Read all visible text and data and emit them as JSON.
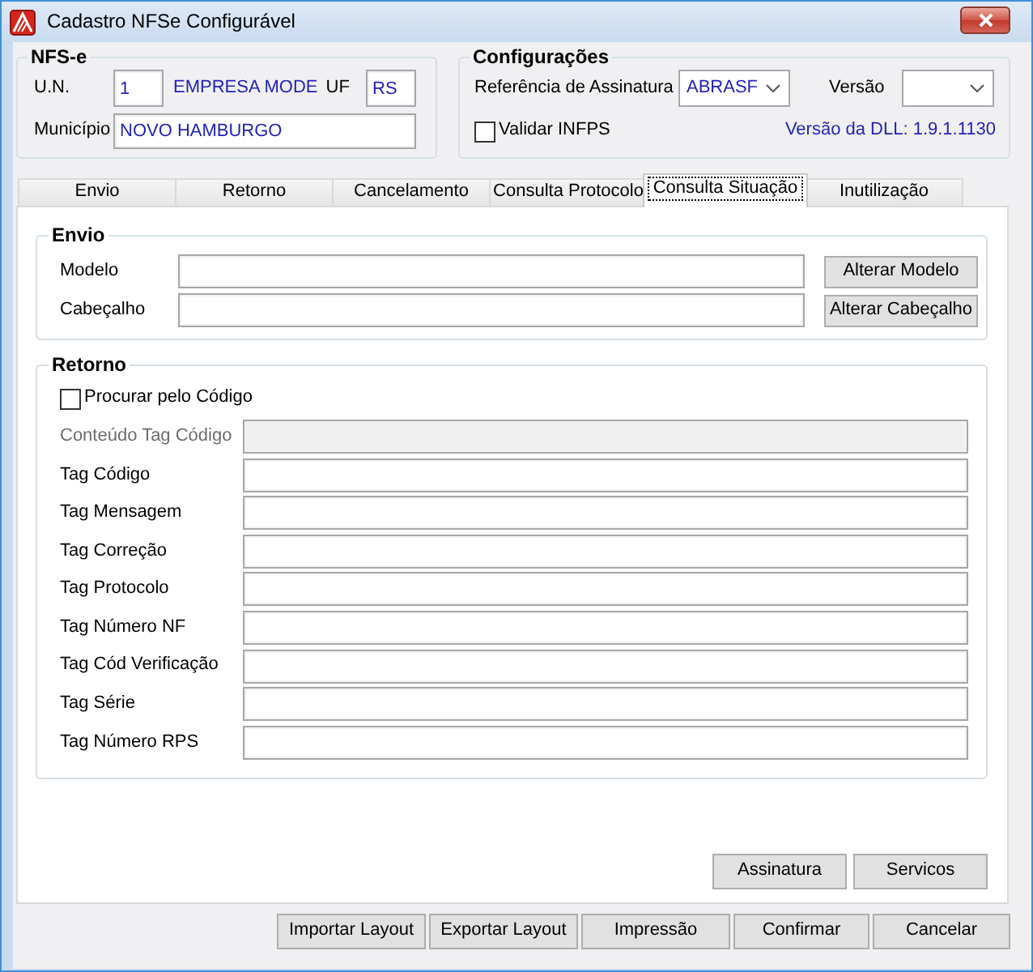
{
  "window": {
    "title": "Cadastro NFSe Configurável"
  },
  "nfse": {
    "title": "NFS-e",
    "un_label": "U.N.",
    "un_value": "1",
    "company": "EMPRESA MODE",
    "uf_label": "UF",
    "uf_value": "RS",
    "municipio_label": "Município",
    "municipio_value": "NOVO HAMBURGO"
  },
  "config": {
    "title": "Configurações",
    "signature_label": "Referência de Assinatura",
    "signature_value": "ABRASF",
    "version_label": "Versão",
    "validate": {
      "label": "Validar INFPS",
      "checked": false
    },
    "dll_version": "Versão da DLL: 1.9.1.1130"
  },
  "tabs": [
    {
      "label": "Envio",
      "selected": false
    },
    {
      "label": "Retorno",
      "selected": false
    },
    {
      "label": "Cancelamento",
      "selected": false
    },
    {
      "label": "Consulta Protocolo",
      "selected": false
    },
    {
      "label": "Consulta Situação",
      "selected": true
    },
    {
      "label": "Inutilização",
      "selected": false
    }
  ],
  "envio": {
    "title": "Envio",
    "rows": [
      {
        "label": "Modelo",
        "button": "Alterar Modelo"
      },
      {
        "label": "Cabeçalho",
        "button": "Alterar Cabeçalho"
      }
    ]
  },
  "retorno": {
    "title": "Retorno",
    "search_by_code": {
      "label": "Procurar pelo Código",
      "checked": false
    },
    "fields": [
      {
        "label": "Conteúdo Tag Código",
        "disabled": true
      },
      {
        "label": "Tag Código",
        "disabled": false
      },
      {
        "label": "Tag Mensagem",
        "disabled": false
      },
      {
        "label": "Tag Correção",
        "disabled": false
      },
      {
        "label": "Tag Protocolo",
        "disabled": false
      },
      {
        "label": "Tag Número NF",
        "disabled": false
      },
      {
        "label": "Tag Cód Verificação",
        "disabled": false
      },
      {
        "label": "Tag Série",
        "disabled": false
      },
      {
        "label": "Tag Número RPS",
        "disabled": false
      }
    ]
  },
  "panel_buttons": [
    {
      "label": "Assinatura"
    },
    {
      "label": "Servicos"
    }
  ],
  "buttons": [
    {
      "label": "Importar Layout"
    },
    {
      "label": "Exportar Layout"
    },
    {
      "label": "Impressão"
    },
    {
      "label": "Confirmar"
    },
    {
      "label": "Cancelar"
    }
  ]
}
